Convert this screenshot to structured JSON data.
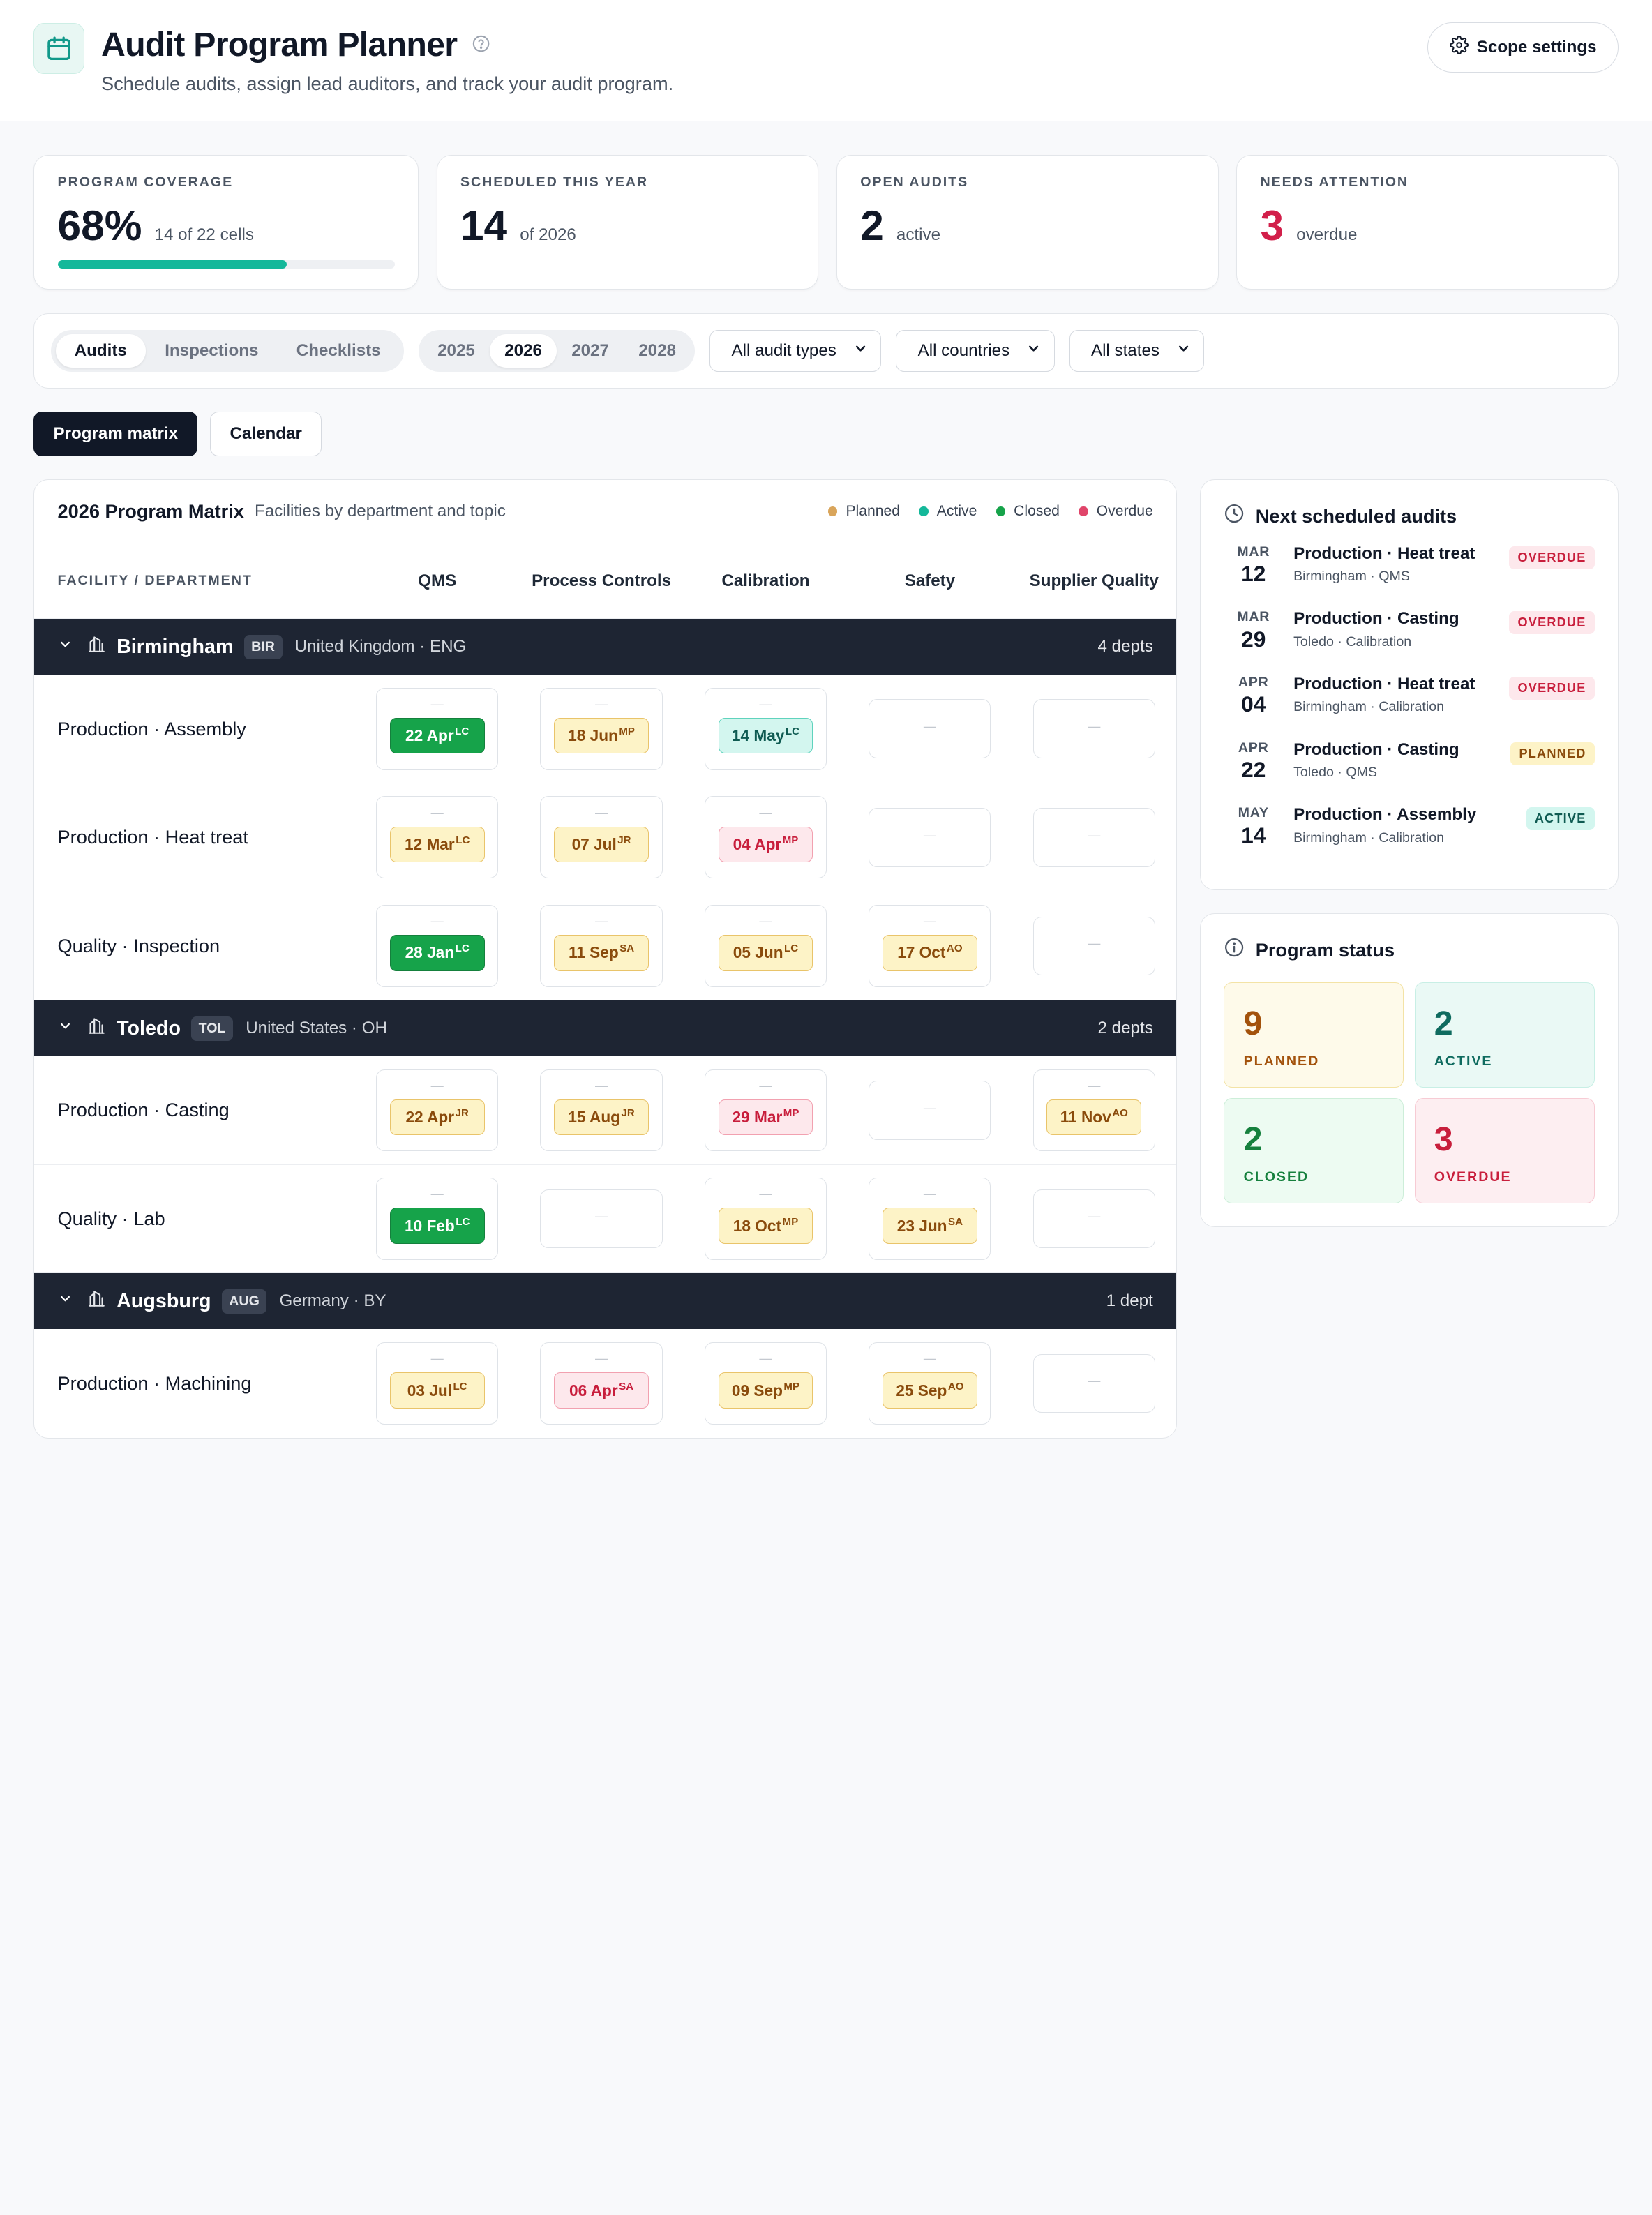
{
  "header": {
    "title": "Audit Program Planner",
    "subtitle": "Schedule audits, assign lead auditors, and track your audit program.",
    "scope_label": "Scope settings"
  },
  "kpis": [
    {
      "label": "PROGRAM COVERAGE",
      "value": "68%",
      "sub": "14 of 22 cells",
      "progress_percent": 68
    },
    {
      "label": "SCHEDULED THIS YEAR",
      "value": "14",
      "sub": "of 2026"
    },
    {
      "label": "OPEN AUDITS",
      "value": "2",
      "sub": "active"
    },
    {
      "label": "NEEDS ATTENTION",
      "value": "3",
      "sub": "overdue"
    }
  ],
  "filters": {
    "tabs": [
      "Audits",
      "Inspections",
      "Checklists"
    ],
    "active_tab": "Audits",
    "years": [
      "2025",
      "2026",
      "2027",
      "2028"
    ],
    "active_year": "2026",
    "audit_type": "All audit types",
    "country": "All countries",
    "state": "All states"
  },
  "views": {
    "matrix": "Program matrix",
    "calendar": "Calendar"
  },
  "matrix": {
    "title": "2026 Program Matrix",
    "subtitle": "Facilities by department and topic",
    "legend": [
      {
        "label": "Planned",
        "color": "#d9a55b"
      },
      {
        "label": "Active",
        "color": "#14b89a"
      },
      {
        "label": "Closed",
        "color": "#16a34a"
      },
      {
        "label": "Overdue",
        "color": "#e0456a"
      }
    ],
    "col_first": "FACILITY / DEPARTMENT",
    "columns": [
      "QMS",
      "Process Controls",
      "Calibration",
      "Safety",
      "Supplier Quality"
    ],
    "empty_mark": "—",
    "facilities": [
      {
        "name": "Birmingham",
        "code": "BIR",
        "location": "United Kingdom · ENG",
        "depts": "4 depts",
        "rows": [
          {
            "name": "Production · Assembly",
            "cells": [
              {
                "date": "22 Apr",
                "ini": "LC",
                "status": "closed"
              },
              {
                "date": "18 Jun",
                "ini": "MP",
                "status": "planned"
              },
              {
                "date": "14 May",
                "ini": "LC",
                "status": "active"
              },
              null,
              null
            ]
          },
          {
            "name": "Production · Heat treat",
            "cells": [
              {
                "date": "12 Mar",
                "ini": "LC",
                "status": "planned"
              },
              {
                "date": "07 Jul",
                "ini": "JR",
                "status": "planned"
              },
              {
                "date": "04 Apr",
                "ini": "MP",
                "status": "overdue"
              },
              null,
              null
            ]
          },
          {
            "name": "Quality · Inspection",
            "cells": [
              {
                "date": "28 Jan",
                "ini": "LC",
                "status": "closed"
              },
              {
                "date": "11 Sep",
                "ini": "SA",
                "status": "planned"
              },
              {
                "date": "05 Jun",
                "ini": "LC",
                "status": "planned"
              },
              {
                "date": "17 Oct",
                "ini": "AO",
                "status": "planned"
              },
              null
            ]
          }
        ]
      },
      {
        "name": "Toledo",
        "code": "TOL",
        "location": "United States · OH",
        "depts": "2 depts",
        "rows": [
          {
            "name": "Production · Casting",
            "cells": [
              {
                "date": "22 Apr",
                "ini": "JR",
                "status": "planned"
              },
              {
                "date": "15 Aug",
                "ini": "JR",
                "status": "planned"
              },
              {
                "date": "29 Mar",
                "ini": "MP",
                "status": "overdue"
              },
              null,
              {
                "date": "11 Nov",
                "ini": "AO",
                "status": "planned"
              }
            ]
          },
          {
            "name": "Quality · Lab",
            "cells": [
              {
                "date": "10 Feb",
                "ini": "LC",
                "status": "closed"
              },
              null,
              {
                "date": "18 Oct",
                "ini": "MP",
                "status": "planned"
              },
              {
                "date": "23 Jun",
                "ini": "SA",
                "status": "planned"
              },
              null
            ]
          }
        ]
      },
      {
        "name": "Augsburg",
        "code": "AUG",
        "location": "Germany · BY",
        "depts": "1 dept",
        "rows": [
          {
            "name": "Production · Machining",
            "cells": [
              {
                "date": "03 Jul",
                "ini": "LC",
                "status": "planned"
              },
              {
                "date": "06 Apr",
                "ini": "SA",
                "status": "overdue"
              },
              {
                "date": "09 Sep",
                "ini": "MP",
                "status": "planned"
              },
              {
                "date": "25 Sep",
                "ini": "AO",
                "status": "planned"
              },
              null
            ]
          }
        ]
      }
    ]
  },
  "next_audits": {
    "title": "Next scheduled audits",
    "items": [
      {
        "mon": "MAR",
        "day": "12",
        "title": "Production · Heat treat",
        "sub": "Birmingham · QMS",
        "badge": "OVERDUE",
        "status": "overdue"
      },
      {
        "mon": "MAR",
        "day": "29",
        "title": "Production · Casting",
        "sub": "Toledo · Calibration",
        "badge": "OVERDUE",
        "status": "overdue"
      },
      {
        "mon": "APR",
        "day": "04",
        "title": "Production · Heat treat",
        "sub": "Birmingham · Calibration",
        "badge": "OVERDUE",
        "status": "overdue"
      },
      {
        "mon": "APR",
        "day": "22",
        "title": "Production · Casting",
        "sub": "Toledo · QMS",
        "badge": "PLANNED",
        "status": "planned"
      },
      {
        "mon": "MAY",
        "day": "14",
        "title": "Production · Assembly",
        "sub": "Birmingham · Calibration",
        "badge": "ACTIVE",
        "status": "active"
      }
    ]
  },
  "program_status": {
    "title": "Program status",
    "cards": [
      {
        "num": "9",
        "label": "PLANNED",
        "status": "planned"
      },
      {
        "num": "2",
        "label": "ACTIVE",
        "status": "active"
      },
      {
        "num": "2",
        "label": "CLOSED",
        "status": "closed"
      },
      {
        "num": "3",
        "label": "OVERDUE",
        "status": "overdue"
      }
    ]
  }
}
